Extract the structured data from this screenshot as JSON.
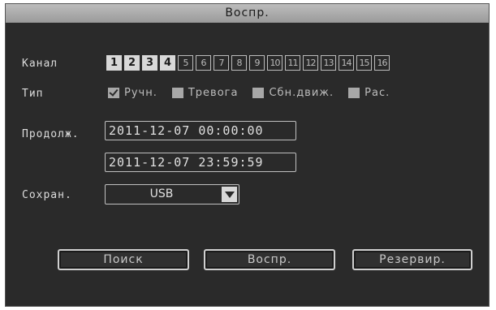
{
  "window": {
    "title": "Воспр."
  },
  "labels": {
    "channel": "Канал",
    "type": "Тип",
    "duration": "Продолж.",
    "save": "Сохран."
  },
  "channels": [
    {
      "label": "1",
      "selected": true
    },
    {
      "label": "2",
      "selected": true
    },
    {
      "label": "3",
      "selected": true
    },
    {
      "label": "4",
      "selected": true
    },
    {
      "label": "5",
      "selected": false
    },
    {
      "label": "6",
      "selected": false
    },
    {
      "label": "7",
      "selected": false
    },
    {
      "label": "8",
      "selected": false
    },
    {
      "label": "9",
      "selected": false
    },
    {
      "label": "10",
      "selected": false
    },
    {
      "label": "11",
      "selected": false
    },
    {
      "label": "12",
      "selected": false
    },
    {
      "label": "13",
      "selected": false
    },
    {
      "label": "14",
      "selected": false
    },
    {
      "label": "15",
      "selected": false
    },
    {
      "label": "16",
      "selected": false
    }
  ],
  "types": [
    {
      "label": "Ручн.",
      "checked": true
    },
    {
      "label": "Тревога",
      "checked": false
    },
    {
      "label": "Сбн.движ.",
      "checked": false
    },
    {
      "label": "Рас.",
      "checked": false
    }
  ],
  "start_time": "2011-12-07 00:00:00",
  "end_time": "2011-12-07 23:59:59",
  "save_target": {
    "value": "USB"
  },
  "buttons": {
    "search": "Поиск",
    "play": "Воспр.",
    "backup": "Резервир."
  }
}
